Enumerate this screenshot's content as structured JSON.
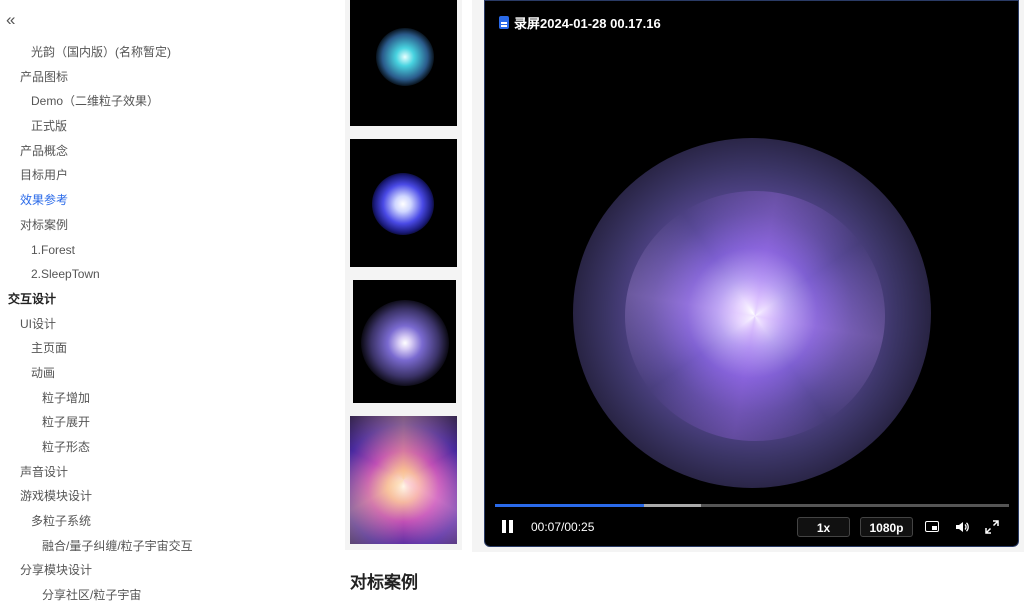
{
  "sidebar": {
    "collapse_icon": "«",
    "items": [
      {
        "label": "光韵（国内版）(名称暂定)",
        "level": 2
      },
      {
        "label": "产品图标",
        "level": 1
      },
      {
        "label": "Demo（二维粒子效果）",
        "level": 2
      },
      {
        "label": "正式版",
        "level": 2
      },
      {
        "label": "产品概念",
        "level": 1
      },
      {
        "label": "目标用户",
        "level": 1
      },
      {
        "label": "效果参考",
        "level": 1,
        "active": true
      },
      {
        "label": "对标案例",
        "level": 1
      },
      {
        "label": "1.Forest",
        "level": 2
      },
      {
        "label": "2.SleepTown",
        "level": 2
      },
      {
        "label": "交互设计",
        "level": 0
      },
      {
        "label": "UI设计",
        "level": 1
      },
      {
        "label": "主页面",
        "level": 2
      },
      {
        "label": "动画",
        "level": 2
      },
      {
        "label": "粒子增加",
        "level": 3
      },
      {
        "label": "粒子展开",
        "level": 3
      },
      {
        "label": "粒子形态",
        "level": 3
      },
      {
        "label": "声音设计",
        "level": 1
      },
      {
        "label": "游戏模块设计",
        "level": 1
      },
      {
        "label": "多粒子系统",
        "level": 2
      },
      {
        "label": "融合/量子纠缠/粒子宇宙交互",
        "level": 3
      },
      {
        "label": "分享模块设计",
        "level": 1
      },
      {
        "label": "分享社区/粒子宇宙",
        "level": 3
      }
    ]
  },
  "video": {
    "title": "录屏2024-01-28 00.17.16",
    "file_icon": "document-icon",
    "time": "00:07/00:25",
    "played_fraction": 0.29,
    "buffered_fraction": 0.4,
    "rate": "1x",
    "quality": "1080p",
    "accent": "#2a6ae9"
  },
  "section_heading": "对标案例"
}
